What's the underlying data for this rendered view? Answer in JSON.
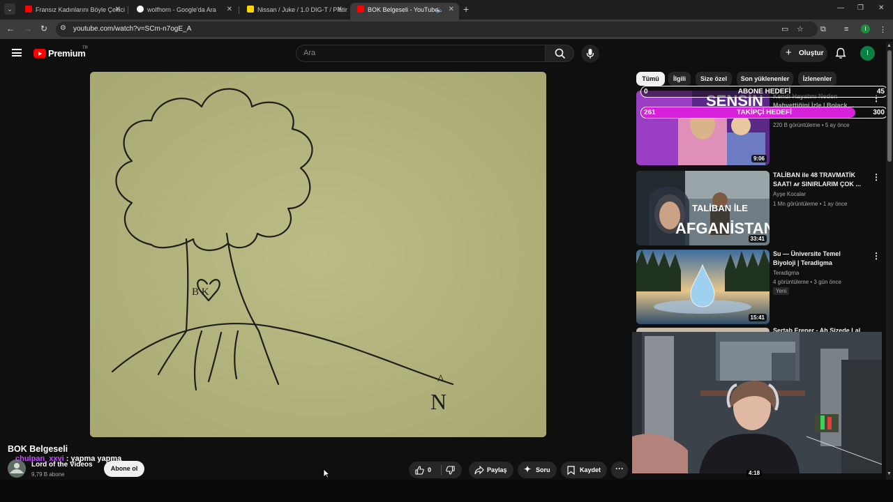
{
  "browser": {
    "tabs": [
      {
        "title": "Fransız Kadınlarını Böyle Çekici",
        "favicon_color": "#ff0000"
      },
      {
        "title": "wolfhorn - Google'da Ara",
        "favicon_color": "#4285f4"
      },
      {
        "title": "Nissan / Juke / 1.0 DIG-T / Platin",
        "favicon_color": "#ffd600"
      },
      {
        "title": "BOK Belgeseli - YouTube",
        "favicon_color": "#ff0000"
      }
    ],
    "url": "youtube.com/watch?v=SCm-n7ogE_A",
    "profile_initial": "I"
  },
  "masthead": {
    "logo_label": "Premium",
    "country_code": "TR",
    "search_placeholder": "Ara",
    "create_label": "Oluştur",
    "avatar_initial": "I"
  },
  "video": {
    "title": "BOK Belgeseli",
    "drawing_text_initials": "B  K",
    "drawing_text_n": "N",
    "drawing_text_hat": "^"
  },
  "chat_overlay": {
    "user": "chulpan_xxvi",
    "message": ": yapma yapma"
  },
  "channel": {
    "name": "Lord of the Videos",
    "subscribers": "9,79 B abone",
    "subscribe_label": "Abone ol"
  },
  "actions": {
    "like_count": "0",
    "share_label": "Paylaş",
    "ask_label": "Soru",
    "save_label": "Kaydet"
  },
  "chips": [
    "Tümü",
    "İlgili",
    "Size özel",
    "Son yüklenenler",
    "İzlenenler"
  ],
  "goals": {
    "subscriber": {
      "label": "ABONE HEDEFİ",
      "current": "0",
      "target": "45",
      "progress": 0
    },
    "follower": {
      "label": "TAKİPÇİ HEDEFİ",
      "current": "261",
      "target": "300",
      "progress": 0.87
    }
  },
  "recommendations": [
    {
      "title": "Kendi Hayatını Neden Mahvettiğini İzle | Bojack ...",
      "thumb_text": "SENSİN",
      "channel": "",
      "meta": "220 B görüntüleme • 5 ay önce",
      "duration": "9:06",
      "badge": ""
    },
    {
      "title": "TALİBAN ile 48 TRAVMATİK SAAT! ᴀғ SINIRLARIM ÇOK ...",
      "thumb_text_1": "TALİBAN İLE",
      "thumb_text_2": "AFGANİSTAN",
      "channel": "Ayşe Kocalar",
      "meta": "1 Mn görüntüleme • 1 ay önce",
      "duration": "33:41",
      "badge": ""
    },
    {
      "title": "Su — Üniversite Temel Biyoloji | Teradigma",
      "channel": "Teradigma",
      "meta": "4 görüntüleme • 3 gün önce",
      "duration": "15:41",
      "badge": "Yeni"
    },
    {
      "title": "Sertab Erener - Ah Sizede Lal",
      "duration": "4:18"
    }
  ]
}
